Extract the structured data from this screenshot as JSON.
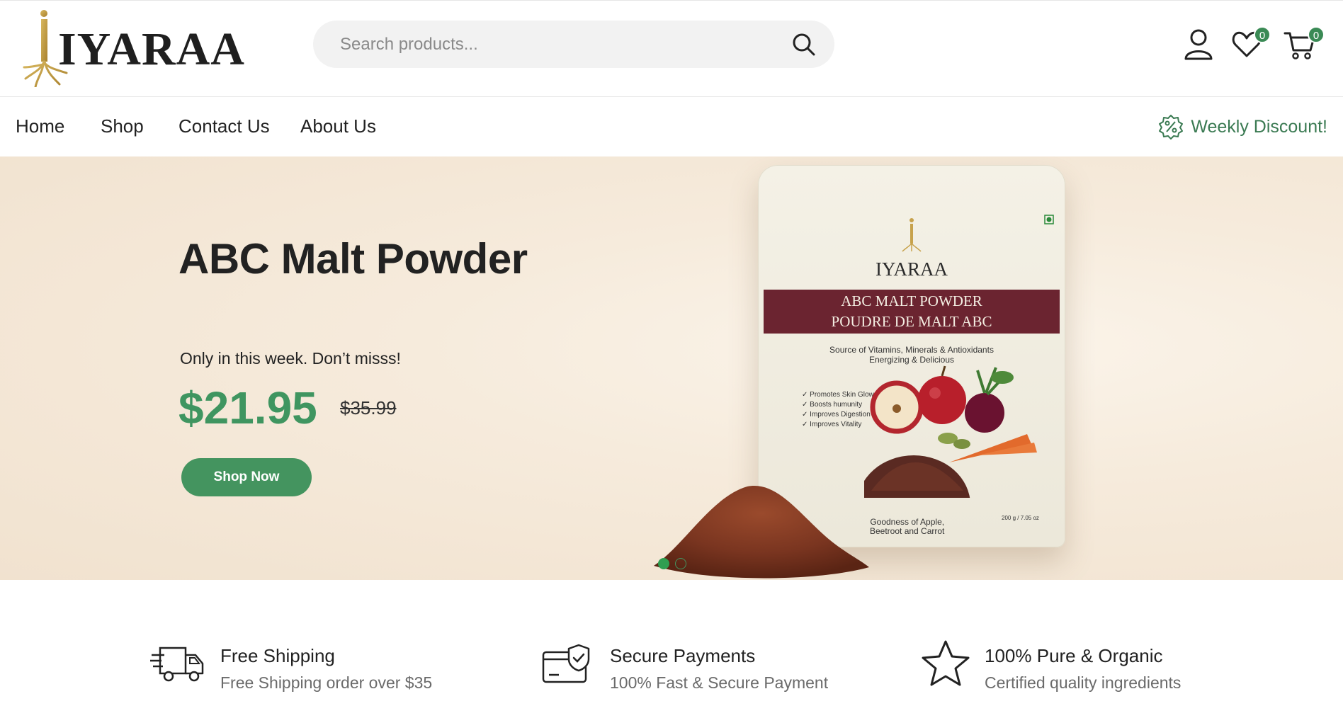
{
  "brand": {
    "name": "IYARAA"
  },
  "search": {
    "placeholder": "Search products..."
  },
  "header": {
    "wishlist_count": "0",
    "cart_count": "0"
  },
  "nav": {
    "items": [
      {
        "label": "Home"
      },
      {
        "label": "Shop"
      },
      {
        "label": "Contact Us"
      },
      {
        "label": "About Us"
      }
    ],
    "promo": "Weekly Discount!"
  },
  "hero": {
    "title": "ABC Malt Powder",
    "subtitle": "Only in this week. Don’t misss!",
    "price": "$21.95",
    "old_price": "$35.99",
    "cta": "Shop Now",
    "slide_count": 2,
    "active_slide": 1,
    "product_image": {
      "brand": "IYARAA",
      "band_line1": "ABC MALT POWDER",
      "band_line2": "POUDRE DE MALT ABC",
      "tagline_line1": "Source of Vitamins, Minerals & Antioxidants",
      "tagline_line2": "Energizing & Delicious",
      "benefits": [
        "Promotes Skin Glow",
        "Boosts humunity",
        "Improves Digestion",
        "Improves Vitality"
      ],
      "footer_line1": "Goodness of Apple,",
      "footer_line2": "Beetroot and Carrot",
      "weight": "200 g / 7.05 oz"
    }
  },
  "features": [
    {
      "icon": "truck-icon",
      "title": "Free Shipping",
      "subtitle": "Free Shipping order over $35"
    },
    {
      "icon": "secure-card-icon",
      "title": "Secure Payments",
      "subtitle": "100% Fast & Secure Payment"
    },
    {
      "icon": "star-icon",
      "title": "100% Pure & Organic",
      "subtitle": "Certified quality ingredients"
    }
  ],
  "colors": {
    "accent": "#44945f",
    "price": "#3f9560",
    "hero_bg": "#f3e6d4",
    "band": "#6b2430"
  }
}
